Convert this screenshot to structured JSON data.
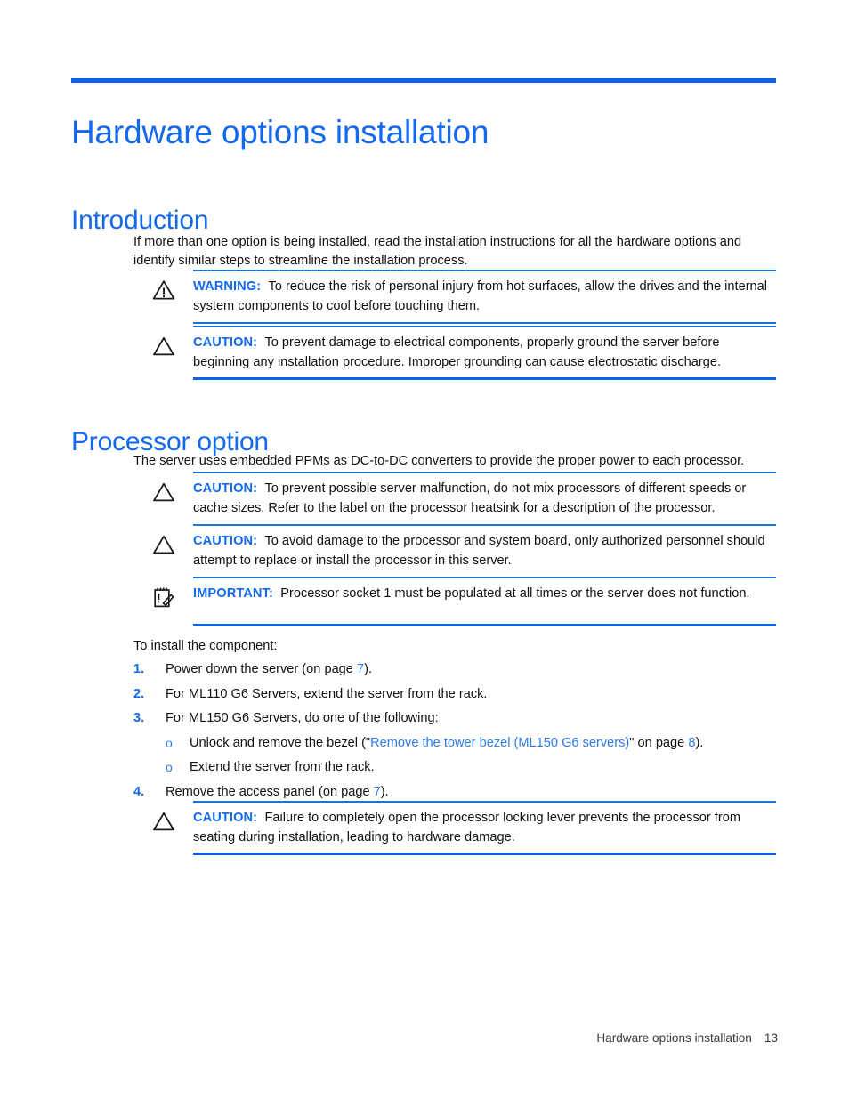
{
  "document": {
    "chapter_title": "Hardware options installation",
    "footer": {
      "text": "Hardware options installation",
      "page_number": "13"
    },
    "accent_color": "#1269f0",
    "rule_color": "#0b61ee"
  },
  "sections": [
    {
      "heading": "Introduction",
      "intro_paragraph": "If more than one option is being installed, read the installation instructions for all the hardware options and identify similar steps to streamline the installation process.",
      "notices": [
        {
          "icon": "warning-triangle-icon",
          "label": "WARNING:",
          "text": "To reduce the risk of personal injury from hot surfaces, allow the drives and the internal system components to cool before touching them."
        },
        {
          "icon": "caution-triangle-icon",
          "label": "CAUTION:",
          "text": "To prevent damage to electrical components, properly ground the server before beginning any installation procedure. Improper grounding can cause electrostatic discharge."
        }
      ]
    },
    {
      "heading": "Processor option",
      "intro_paragraph": "The server uses embedded PPMs as DC-to-DC converters to provide the proper power to each processor.",
      "notices": [
        {
          "icon": "caution-triangle-icon",
          "label": "CAUTION:",
          "text": "To prevent possible server malfunction, do not mix processors of different speeds or cache sizes. Refer to the label on the processor heatsink for a description of the processor."
        },
        {
          "icon": "caution-triangle-icon",
          "label": "CAUTION:",
          "text": "To avoid damage to the processor and system board, only authorized personnel should attempt to replace or install the processor in this server."
        },
        {
          "icon": "important-notepad-icon",
          "label": "IMPORTANT:",
          "text": "Processor socket 1 must be populated at all times or the server does not function."
        }
      ]
    }
  ],
  "procedure": {
    "lead_in": "To install the component:",
    "steps": [
      {
        "marker": "1.",
        "prefix": "Power down the server (on page ",
        "page_ref": "7",
        "suffix": ")."
      },
      {
        "marker": "2.",
        "text": "For ML110 G6 Servers, extend the server from the rack."
      },
      {
        "marker": "3.",
        "text": "For ML150 G6 Servers, do one of the following:",
        "substeps": [
          {
            "marker": "o",
            "prefix": "Unlock and remove the bezel (\"",
            "link": "Remove the tower bezel (ML150 G6 servers)",
            "middle": "\" on page ",
            "page_ref": "8",
            "suffix": ")."
          },
          {
            "marker": "o",
            "text": "Extend the server from the rack."
          }
        ]
      },
      {
        "marker": "4.",
        "prefix": "Remove the access panel (on page ",
        "page_ref": "7",
        "suffix": ")."
      }
    ],
    "final_notice": {
      "icon": "caution-triangle-icon",
      "label": "CAUTION:",
      "text": "Failure to completely open the processor locking lever prevents the processor from seating during installation, leading to hardware damage."
    }
  }
}
